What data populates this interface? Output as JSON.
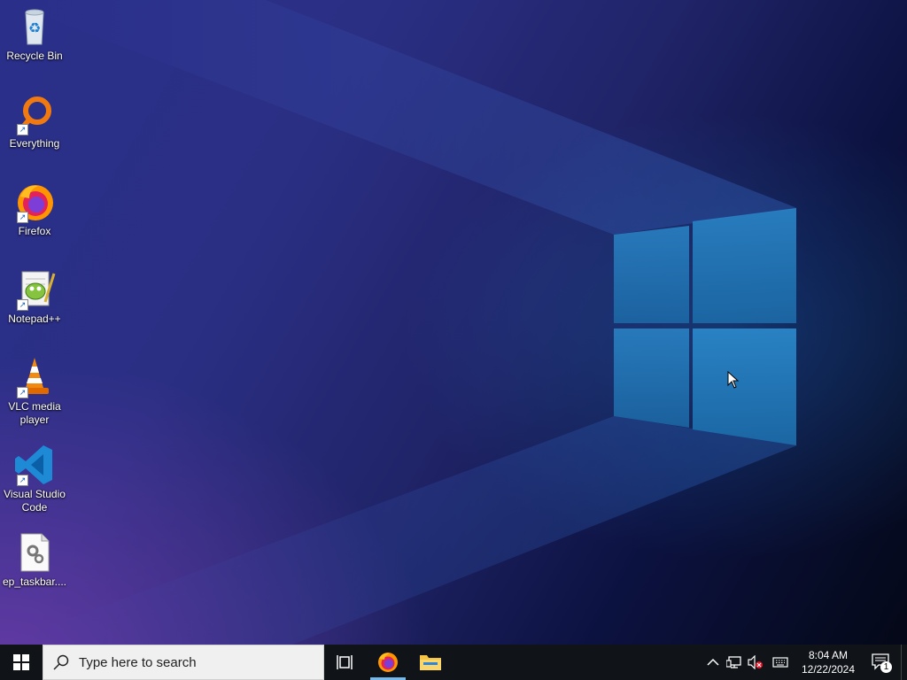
{
  "desktop": {
    "icons": [
      {
        "label": "Recycle Bin",
        "icon": "recycle-bin-icon"
      },
      {
        "label": "Everything",
        "icon": "everything-search-icon"
      },
      {
        "label": "Firefox",
        "icon": "firefox-icon"
      },
      {
        "label": "Notepad++",
        "icon": "notepad-plus-plus-icon"
      },
      {
        "label": "VLC media player",
        "icon": "vlc-icon"
      },
      {
        "label": "Visual Studio Code",
        "icon": "vscode-icon"
      },
      {
        "label": "ep_taskbar....",
        "icon": "settings-file-icon"
      }
    ]
  },
  "taskbar": {
    "search_placeholder": "Type here to search",
    "pinned": [
      {
        "name": "task-view",
        "icon": "task-view-icon"
      },
      {
        "name": "firefox",
        "icon": "firefox-icon",
        "active": true
      },
      {
        "name": "file-explorer",
        "icon": "folder-icon"
      }
    ],
    "tray": {
      "time": "8:04 AM",
      "date": "12/22/2024",
      "notification_count": "1"
    }
  },
  "colors": {
    "accent": "#76b9ed",
    "taskbar": "#101318",
    "windows_logo": "#1e77c0"
  }
}
